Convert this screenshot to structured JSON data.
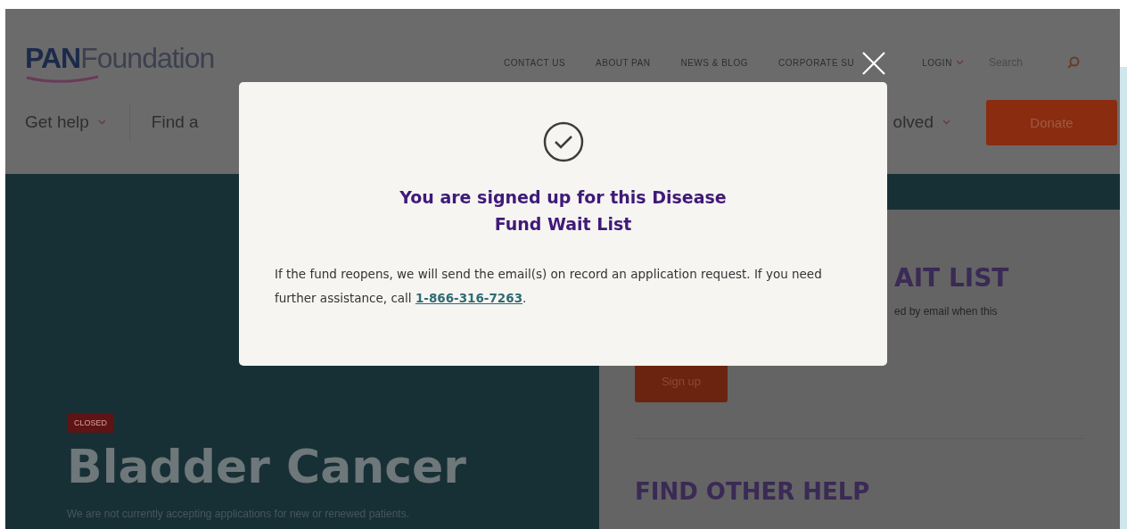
{
  "header": {
    "logo": {
      "brand": "PAN",
      "name": "Foundation"
    },
    "utility_nav": [
      {
        "label": "CONTACT US",
        "kind": "link"
      },
      {
        "label": "ABOUT PAN",
        "kind": "link"
      },
      {
        "label": "NEWS & BLOG",
        "kind": "link"
      },
      {
        "label": "CORPORATE SU",
        "kind": "link"
      },
      {
        "label": "LOGIN",
        "kind": "dropdown"
      }
    ],
    "search": {
      "placeholder": "Search"
    },
    "main_nav": [
      {
        "label": "Get help",
        "kind": "dropdown"
      },
      {
        "label": "Find a",
        "kind": "link"
      },
      {
        "label": "olved",
        "kind": "dropdown"
      }
    ],
    "donate": "Donate"
  },
  "hero": {
    "badge": "CLOSED",
    "title": "Bladder Cancer",
    "subtitle": "We are not currently accepting applications for new or renewed patients."
  },
  "side_card": {
    "heading": "AIT LIST",
    "text": "ed by email when this",
    "button": "Sign up",
    "section_heading": "FIND OTHER HELP"
  },
  "modal": {
    "title": "You are signed up for this Disease Fund Wait List",
    "message": "If the fund reopens, we will send the email(s) on record an application request. If you need further assistance, call ",
    "phone": "1-866-316-7263",
    "message_end": "."
  }
}
